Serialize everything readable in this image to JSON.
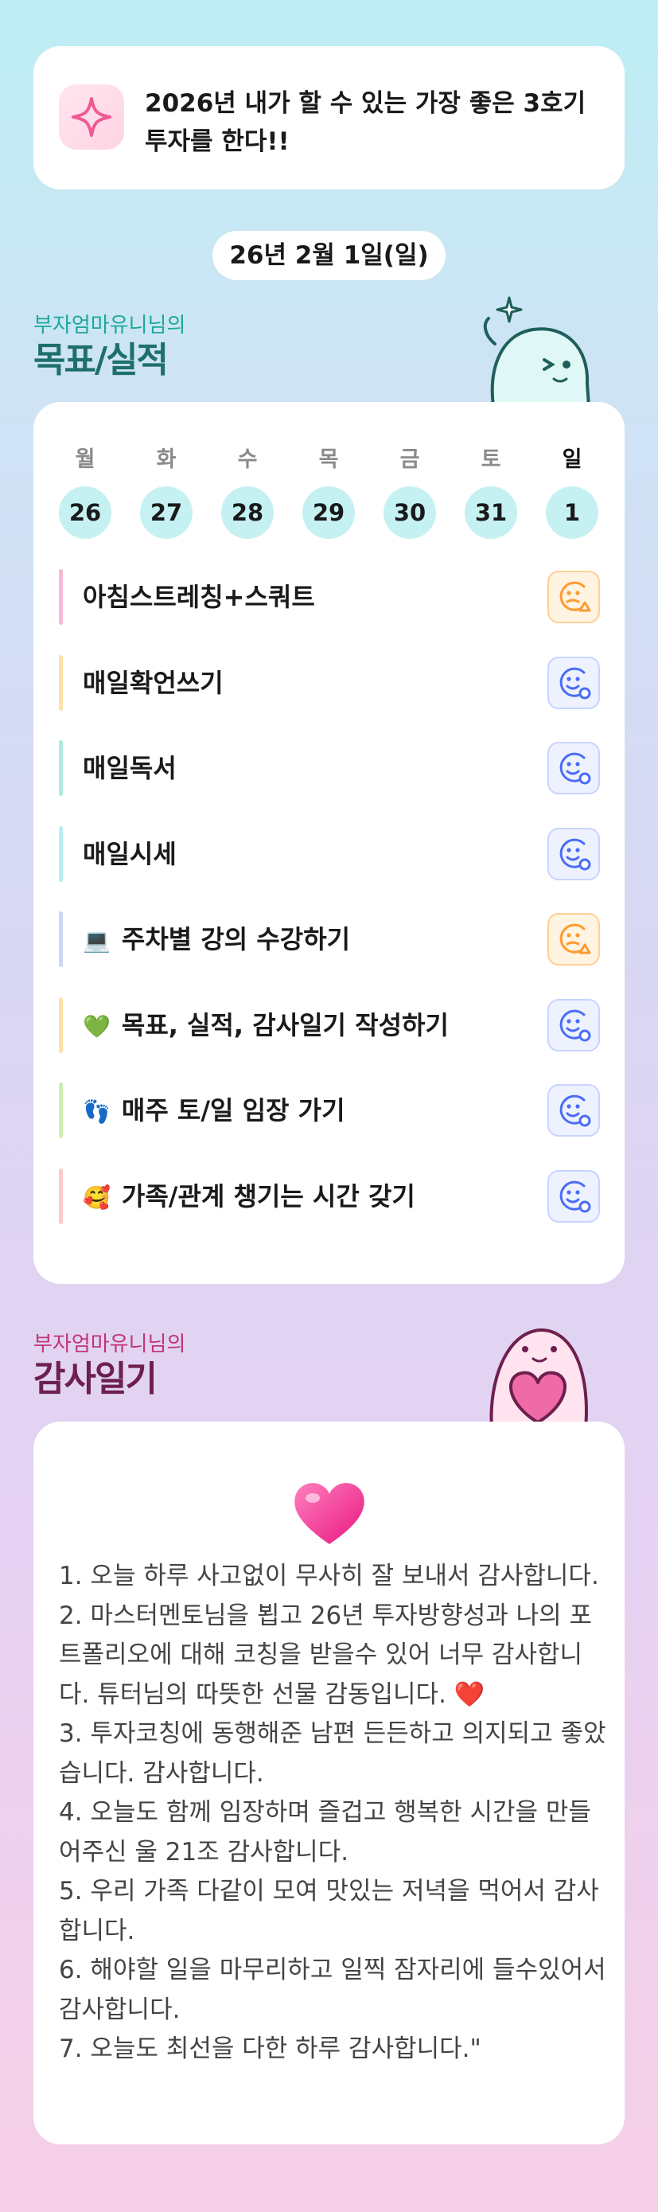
{
  "goal": {
    "text": "2026년 내가 할 수 있는 가장 좋은 3호기 투자를 한다!!",
    "icon": "sparkle-icon"
  },
  "date": "26년 2월 1일(일)",
  "record_section": {
    "subtitle": "부자엄마유니님의",
    "title": "목표/실적"
  },
  "week": {
    "days": [
      {
        "name": "월",
        "num": "26"
      },
      {
        "name": "화",
        "num": "27"
      },
      {
        "name": "수",
        "num": "28"
      },
      {
        "name": "목",
        "num": "29"
      },
      {
        "name": "금",
        "num": "30"
      },
      {
        "name": "토",
        "num": "31"
      },
      {
        "name": "일",
        "num": "1"
      }
    ]
  },
  "tasks": [
    {
      "emoji": "",
      "label": "아침스트레칭+스쿼트",
      "bar_color": "#f7b8d6",
      "status": "not-done"
    },
    {
      "emoji": "",
      "label": "매일확언쓰기",
      "bar_color": "#ffe1a8",
      "status": "done"
    },
    {
      "emoji": "",
      "label": "매일독서",
      "bar_color": "#aeeadf",
      "status": "done"
    },
    {
      "emoji": "",
      "label": "매일시세",
      "bar_color": "#b6eef3",
      "status": "done"
    },
    {
      "emoji": "💻",
      "label": "주차별 강의 수강하기",
      "bar_color": "#cfd7f7",
      "status": "not-done"
    },
    {
      "emoji": "💚",
      "label": "목표, 실적, 감사일기 작성하기",
      "bar_color": "#ffe1a8",
      "status": "done"
    },
    {
      "emoji": "👣",
      "label": "매주 토/일 임장 가기",
      "bar_color": "#cdeeb0",
      "status": "done"
    },
    {
      "emoji": "🥰",
      "label": "가족/관계 챙기는 시간 갖기",
      "bar_color": "#ffc9c9",
      "status": "done"
    }
  ],
  "gratitude_section": {
    "subtitle": "부자엄마유니님의",
    "title": "감사일기"
  },
  "gratitude": {
    "lines": [
      "1. 오늘 하루 사고없이 무사히 잘 보내서 감사합니다.",
      "2. 마스터멘토님을 뵙고 26년 투자방향성과 나의 포트폴리오에 대해 코칭을 받을수 있어 너무 감사합니다.  튜터님의 따뜻한 선물 감동입니다. ❤️",
      "3. 투자코칭에 동행해준 남편  든든하고 의지되고 좋았습니다. 감사합니다.",
      "4. 오늘도 함께 임장하며 즐겁고 행복한 시간을 만들어주신 울 21조 감사합니다.",
      "5. 우리 가족 다같이 모여 맛있는 저녁을 먹어서 감사합니다.",
      "6. 해야할 일을 마무리하고 일찍 잠자리에 들수있어서 감사합니다.",
      "7. 오늘도 최선을 다한 하루 감사합니다.\""
    ]
  },
  "colors": {
    "accent_teal": "#1f6f6a",
    "accent_plum": "#6d1f4e",
    "day_circle": "#c6f1f3"
  }
}
